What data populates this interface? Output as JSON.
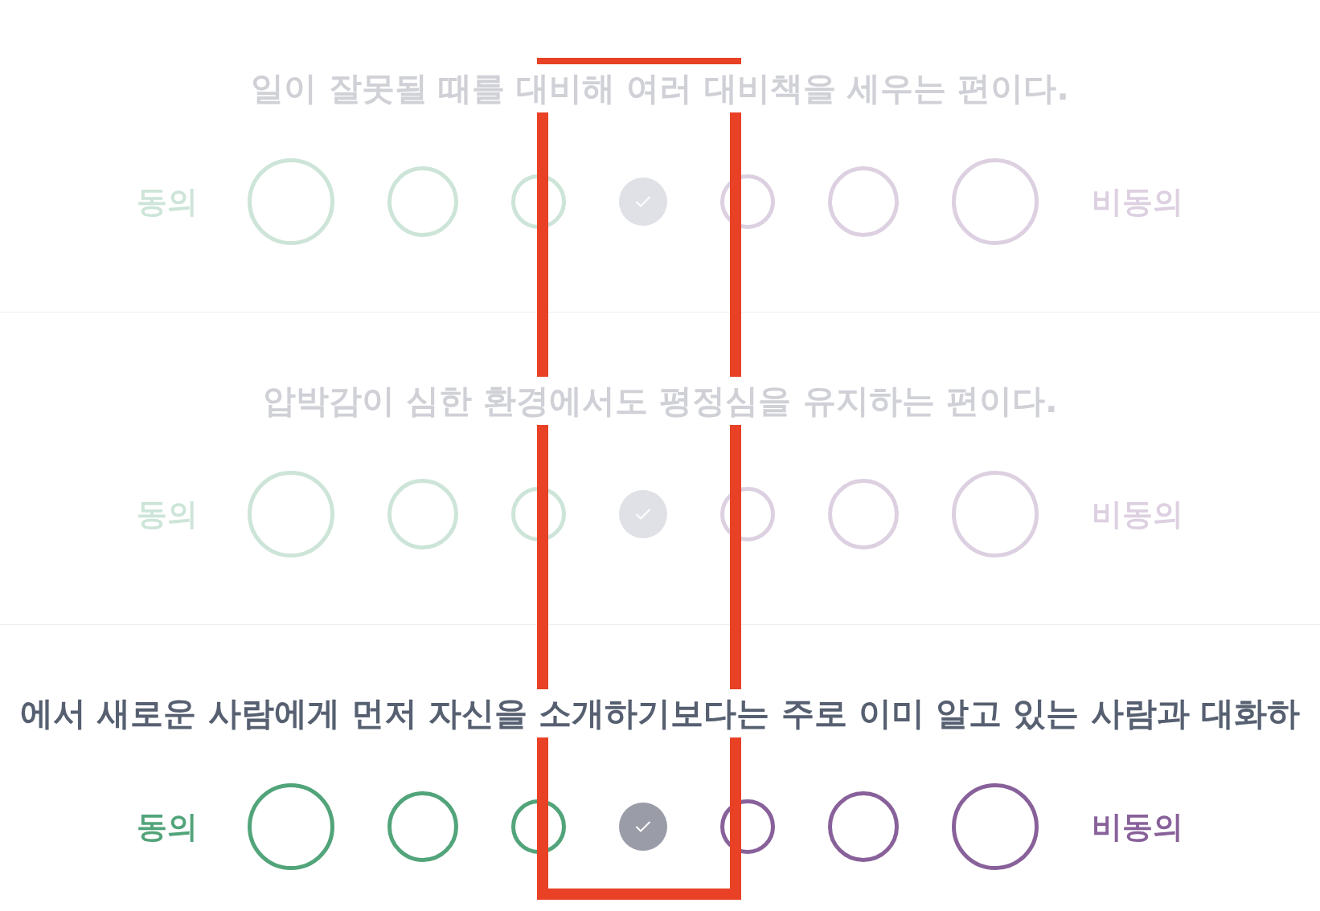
{
  "questions": [
    {
      "text": "일이 잘못될 때를 대비해 여러 대비책을 세우는 편이다.",
      "active": false,
      "agree_label": "동의",
      "disagree_label": "비동의",
      "options": [
        {
          "selected": false
        },
        {
          "selected": false
        },
        {
          "selected": false
        },
        {
          "selected": true
        },
        {
          "selected": false
        },
        {
          "selected": false
        },
        {
          "selected": false
        }
      ]
    },
    {
      "text": "압박감이 심한 환경에서도 평정심을 유지하는 편이다.",
      "active": false,
      "agree_label": "동의",
      "disagree_label": "비동의",
      "options": [
        {
          "selected": false
        },
        {
          "selected": false
        },
        {
          "selected": false
        },
        {
          "selected": true
        },
        {
          "selected": false
        },
        {
          "selected": false
        },
        {
          "selected": false
        }
      ]
    },
    {
      "text": "에서 새로운 사람에게 먼저 자신을 소개하기보다는 주로 이미 알고 있는 사람과 대화하",
      "active": true,
      "agree_label": "동의",
      "disagree_label": "비동의",
      "options": [
        {
          "selected": false
        },
        {
          "selected": false
        },
        {
          "selected": false
        },
        {
          "selected": true
        },
        {
          "selected": false
        },
        {
          "selected": false
        },
        {
          "selected": false
        }
      ]
    }
  ]
}
